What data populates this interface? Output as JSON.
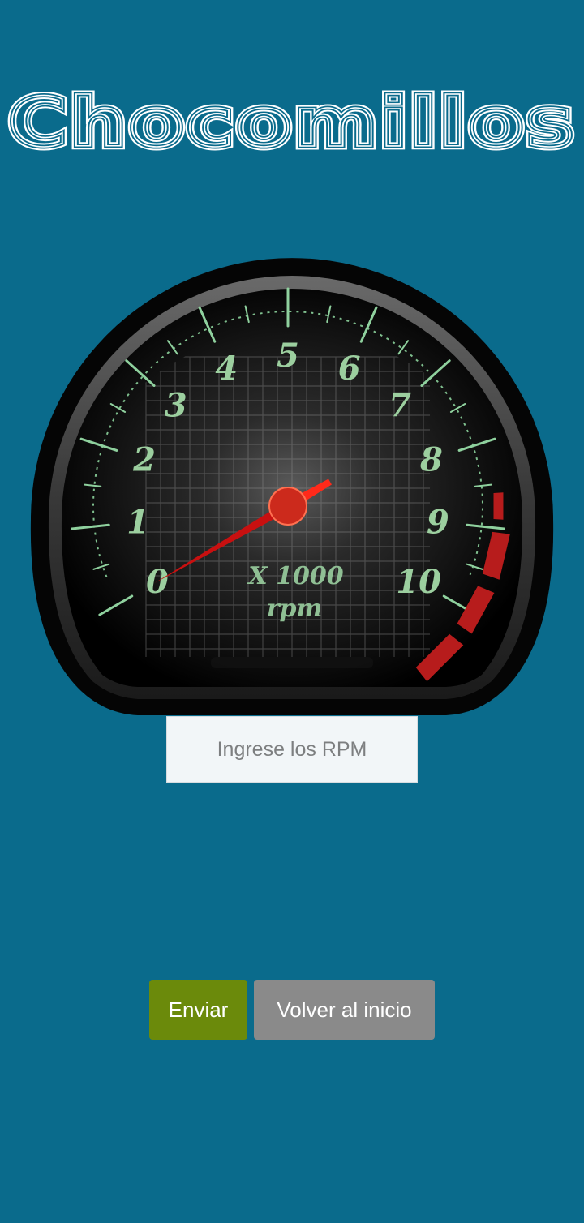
{
  "app": {
    "title": "Chocomillos"
  },
  "gauge": {
    "labels": [
      "0",
      "1",
      "2",
      "3",
      "4",
      "5",
      "6",
      "7",
      "8",
      "9",
      "10"
    ],
    "unit_multiplier": "X 1000",
    "unit": "rpm",
    "needle_value": 0,
    "colors": {
      "ticks": "#8fd19e",
      "redline": "#b71c1c",
      "needle": "#e01010"
    }
  },
  "form": {
    "rpm_placeholder": "Ingrese los RPM",
    "rpm_value": ""
  },
  "actions": {
    "send_label": "Enviar",
    "back_label": "Volver al inicio"
  }
}
